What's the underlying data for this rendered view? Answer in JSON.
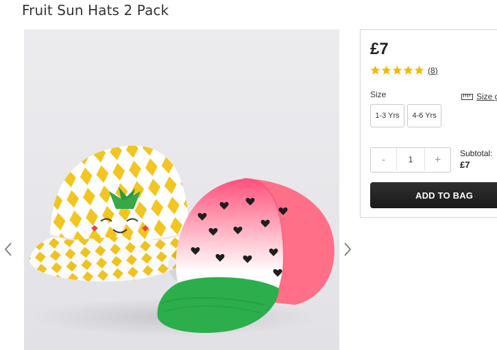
{
  "product": {
    "title": "Fruit Sun Hats 2 Pack",
    "price": "£7",
    "rating": {
      "stars": 5,
      "review_count": "(8)"
    }
  },
  "size": {
    "label": "Size",
    "guide_label": "Size g",
    "options": [
      "1-3 Yrs",
      "4-6 Yrs"
    ]
  },
  "quantity": {
    "minus": "-",
    "value": "1",
    "plus": "+"
  },
  "subtotal": {
    "label": "Subtotal:",
    "value": "£7"
  },
  "actions": {
    "add_to_bag": "ADD TO BAG"
  },
  "colors": {
    "star": "#f5b800",
    "button_dark": "#222222",
    "hat_yellow": "#f2c51f",
    "cap_pink": "#ff6f86",
    "cap_green": "#2cae4c"
  }
}
